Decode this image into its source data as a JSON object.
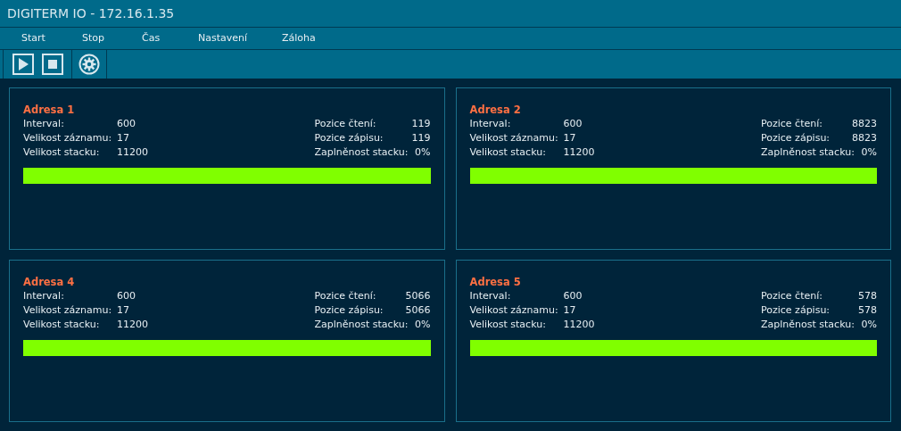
{
  "window": {
    "title": "DIGITERM IO - 172.16.1.35"
  },
  "menu": [
    "Start",
    "Stop",
    "Čas",
    "Nastavení",
    "Záloha"
  ],
  "panels": [
    {
      "title": "Adresa 1",
      "left": [
        {
          "label": "Interval:",
          "value": "600"
        },
        {
          "label": "Velikost záznamu:",
          "value": "17"
        },
        {
          "label": "Velikost stacku:",
          "value": "11200"
        }
      ],
      "right": [
        {
          "label": "Pozice čtení:",
          "value": "119"
        },
        {
          "label": "Pozice zápisu:",
          "value": "119"
        },
        {
          "label": "Zaplněnost stacku:",
          "value": "0%"
        }
      ],
      "level": 1
    },
    {
      "title": "Adresa 2",
      "left": [
        {
          "label": "Interval:",
          "value": "600"
        },
        {
          "label": "Velikost záznamu:",
          "value": "17"
        },
        {
          "label": "Velikost stacku:",
          "value": "11200"
        }
      ],
      "right": [
        {
          "label": "Pozice čtení:",
          "value": "8823"
        },
        {
          "label": "Pozice zápisu:",
          "value": "8823"
        },
        {
          "label": "Zaplněnost stacku:",
          "value": "0%"
        }
      ],
      "level": 1
    },
    {
      "title": "Adresa 4",
      "left": [
        {
          "label": "Interval:",
          "value": "600"
        },
        {
          "label": "Velikost záznamu:",
          "value": "17"
        },
        {
          "label": "Velikost stacku:",
          "value": "11200"
        }
      ],
      "right": [
        {
          "label": "Pozice čtení:",
          "value": "5066"
        },
        {
          "label": "Pozice zápisu:",
          "value": "5066"
        },
        {
          "label": "Zaplněnost stacku:",
          "value": "0%"
        }
      ],
      "level": 1
    },
    {
      "title": "Adresa 5",
      "left": [
        {
          "label": "Interval:",
          "value": "600"
        },
        {
          "label": "Velikost záznamu:",
          "value": "17"
        },
        {
          "label": "Velikost stacku:",
          "value": "11200"
        }
      ],
      "right": [
        {
          "label": "Pozice čtení:",
          "value": "578"
        },
        {
          "label": "Pozice zápisu:",
          "value": "578"
        },
        {
          "label": "Zaplněnost stacku:",
          "value": "0%"
        }
      ],
      "level": 1
    }
  ]
}
